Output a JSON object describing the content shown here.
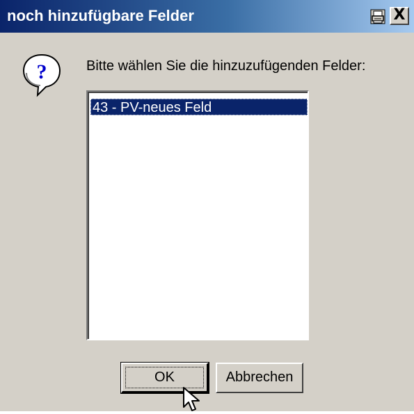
{
  "window": {
    "title": "noch hinzufügbare Felder",
    "print_icon": "printer-icon",
    "close_label": "X"
  },
  "dialog": {
    "icon": "question-icon",
    "prompt": "Bitte wählen Sie die hinzuzufügenden Felder:",
    "list_items": [
      {
        "label": "43 - PV-neues Feld",
        "selected": true
      }
    ]
  },
  "buttons": {
    "ok_label": "OK",
    "cancel_label": "Abbrechen"
  },
  "colors": {
    "titlebar_start": "#0a246a",
    "titlebar_end": "#a6caf0",
    "dialog_bg": "#d4d0c8",
    "selection_bg": "#0a246a"
  }
}
